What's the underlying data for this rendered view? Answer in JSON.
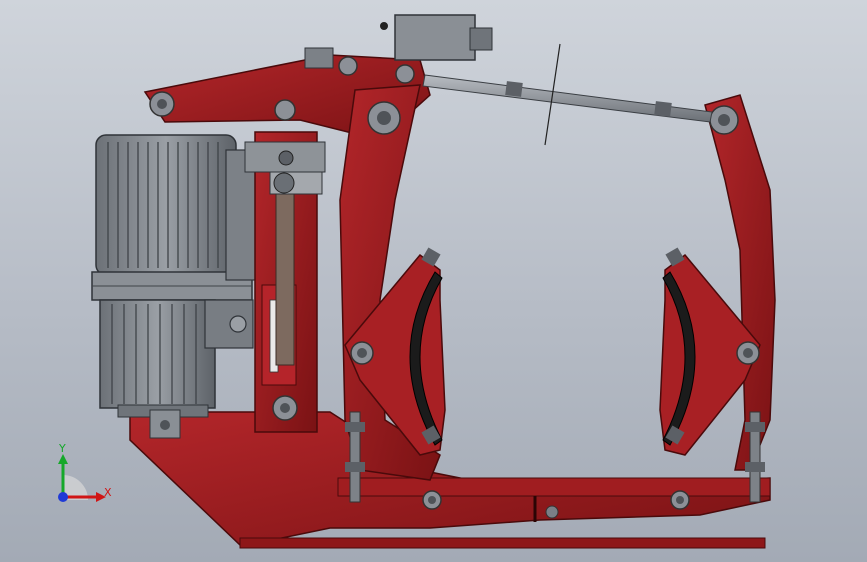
{
  "viewport": {
    "background_top": "#cfd4db",
    "background_bottom": "#a3aab5"
  },
  "palette": {
    "brake_red": "#9a1a1c",
    "brake_red_dark": "#5e0b0d",
    "motor_gray": "#7f848a",
    "steel": "#8a8f96",
    "pad_black": "#1b1b1b"
  },
  "parts": [
    "electro-hydraulic-thruster-motor",
    "thruster-push-rod",
    "top-lever-arm",
    "left-brake-arm",
    "right-brake-arm",
    "left-brake-shoe",
    "right-brake-shoe",
    "tie-rod",
    "limit-switch",
    "base-frame",
    "adjusting-bolts"
  ],
  "triad": {
    "x_label": "X",
    "y_label": "Y",
    "x_color": "#d01515",
    "y_color": "#15a82a",
    "z_color": "#1f3ad6"
  }
}
